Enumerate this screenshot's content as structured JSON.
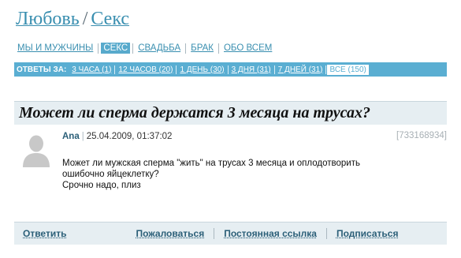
{
  "breadcrumb": {
    "section": "Любовь",
    "subsection": "Секс"
  },
  "categories": [
    {
      "label": "мы и мужчины",
      "active": false
    },
    {
      "label": "секс",
      "active": true
    },
    {
      "label": "свадьба",
      "active": false
    },
    {
      "label": "брак",
      "active": false
    },
    {
      "label": "обо всем",
      "active": false
    }
  ],
  "answers_bar": {
    "label": "ОТВЕТЫ ЗА:",
    "items": [
      {
        "label": "3 ЧАСА (1)"
      },
      {
        "label": "12 ЧАСОВ (20)"
      },
      {
        "label": "1 ДЕНЬ (30)"
      },
      {
        "label": "3 ДНЯ (31)"
      },
      {
        "label": "7 ДНЕЙ (31)"
      },
      {
        "label": "ВСЕ (150)",
        "active": true
      }
    ]
  },
  "question": {
    "title": "Может ли сперма держатся 3 месяца на трусах?",
    "author": "Ana",
    "date": "25.04.2009, 01:37:02",
    "id": "[733168934]",
    "body": [
      "Может ли мужская сперма \"жить\" на трусах 3 месяца и оплодотворить",
      "ошибочно яйцеклетку?",
      "Срочно надо, плиз"
    ]
  },
  "actions": {
    "reply": "Ответить",
    "report": "Пожаловаться",
    "permalink": "Постоянная ссылка",
    "subscribe": "Подписаться"
  },
  "colors": {
    "accent": "#5aaed2",
    "link": "#3a8fb0",
    "panel": "#e6eef2"
  },
  "icons": {
    "avatar": "user-silhouette-icon"
  }
}
